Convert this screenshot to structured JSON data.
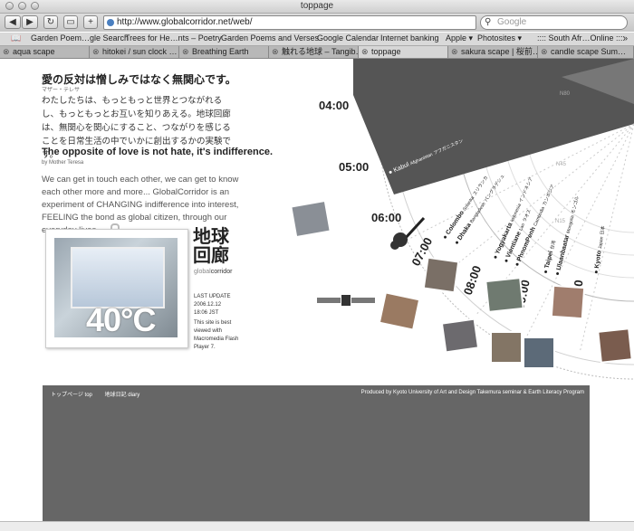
{
  "window": {
    "title": "toppage"
  },
  "toolbar": {
    "back": "◀",
    "forward": "▶",
    "reload": "↻",
    "add": "+",
    "url": "http://www.globalcorridor.net/web/",
    "search_placeholder": "Google",
    "search_icon": "magnifier-icon"
  },
  "bookmarks": {
    "items": [
      "Garden Poem…gle Search",
      "Trees for He…nts – Poetry",
      "Garden Poems and Verses",
      "Google Calendar",
      "Internet banking",
      "Apple ▾",
      "Photosites ▾",
      ":::: South Afr…Online ::::"
    ]
  },
  "tabs": {
    "items": [
      "aqua scape",
      "hitokei / sun clock …",
      "Breathing Earth",
      "触れる地球 – Tangib…",
      "toppage",
      "sakura scape | 桜前…",
      "candle scape Sum…"
    ]
  },
  "content": {
    "jp_title": "愛の反対は憎しみではなく無関心です。",
    "jp_author": "マザー・テレサ",
    "jp_body": "わたしたちは、もっともっと世界とつながれるし、もっともっとお互いを知りあえる。地球回廊は、無関心を関心にすること、つながりを感じることを日常生活の中でいかに創出するかの実験です。",
    "en_title": "The opposite of love is not hate, it's indifference.",
    "en_author": "by Mother Teresa",
    "en_body": "We can get in touch each other, we can get to know each other more and more... GlobalCorridor is an experiment of CHANGING indifference into interest, FEELING the bond as global citizen, through our everyday lives.",
    "temperature": "40°C",
    "logo_kanji": "地球回廊",
    "logo_roman_a": "global",
    "logo_roman_b": "corridor",
    "last_update_label": "LAST UPDATE",
    "last_update_date": "2006.12.12",
    "last_update_time": "18:06 JST",
    "best_viewed": "This site is best viewed with Macromedia Flash Player 7."
  },
  "map": {
    "times": [
      "04:00",
      "05:00",
      "06:00",
      "07:00",
      "08:00",
      "09:00",
      "10:00"
    ],
    "cities": [
      {
        "city": "Kabul",
        "en": "Afghanistan",
        "jp": "アフガニスタン"
      },
      {
        "city": "Colombo",
        "en": "Srilanka",
        "jp": "スリランカ"
      },
      {
        "city": "Dhaka",
        "en": "Bangladesh",
        "jp": "バングラデシュ"
      },
      {
        "city": "Yogyakarta",
        "en": "Indonesia",
        "jp": "インドネシア"
      },
      {
        "city": "Vientiane",
        "en": "Lao",
        "jp": "ラオス"
      },
      {
        "city": "PhnomPenh",
        "en": "Cambodia",
        "jp": "カンボジア"
      },
      {
        "city": "Taipei",
        "en": "",
        "jp": "台湾"
      },
      {
        "city": "Ulaanbaatar",
        "en": "Mongolia",
        "jp": "モンゴル"
      },
      {
        "city": "Kyoto",
        "en": "Japan",
        "jp": "日本"
      }
    ],
    "lat_labels": [
      "N80",
      "N45",
      "N15"
    ]
  },
  "footer": {
    "nav_top": "トップページ top",
    "nav_diary": "地球日記 diary",
    "credit": "Produced by Kyoto University of Art and Design Takemura seminar & Earth Literacy Program"
  }
}
